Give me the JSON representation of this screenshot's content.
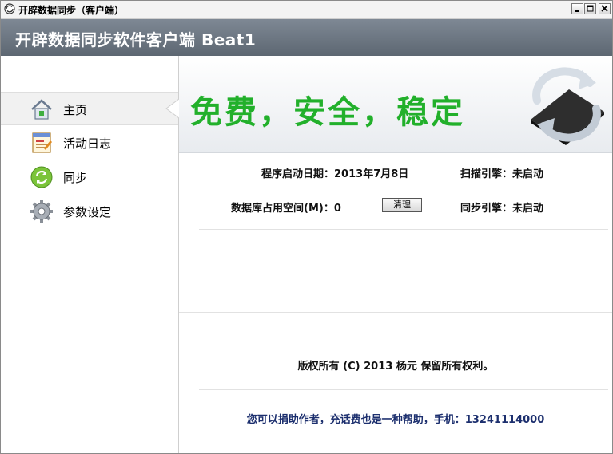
{
  "window": {
    "title": "开辟数据同步（客户端）"
  },
  "header": {
    "app_title": "开辟数据同步软件客户端 Beat1"
  },
  "sidebar": {
    "items": [
      {
        "label": "主页",
        "icon": "home-icon",
        "active": true
      },
      {
        "label": "活动日志",
        "icon": "log-icon",
        "active": false
      },
      {
        "label": "同步",
        "icon": "sync-icon",
        "active": false
      },
      {
        "label": "参数设定",
        "icon": "gear-icon",
        "active": false
      }
    ]
  },
  "banner": {
    "slogan": "免费，安全，稳定",
    "logo_icon": "sync-logo-icon"
  },
  "info": {
    "start_date_label": "程序启动日期：",
    "start_date_value": "2013年7月8日",
    "scan_engine_label": "扫描引擎：",
    "scan_engine_value": "未启动",
    "db_space_label": "数据库占用空间(M)：",
    "db_space_value": "0",
    "clear_button": "清理",
    "sync_engine_label": "同步引擎：",
    "sync_engine_value": "未启动"
  },
  "footer": {
    "copyright": "版权所有 (C) 2013 杨元 保留所有权利。",
    "donate": "您可以捐助作者，充话费也是一种帮助，手机：13241114000"
  },
  "colors": {
    "header_bg": "#6b7580",
    "slogan": "#22b02b",
    "donate_text": "#1c2f6e"
  }
}
